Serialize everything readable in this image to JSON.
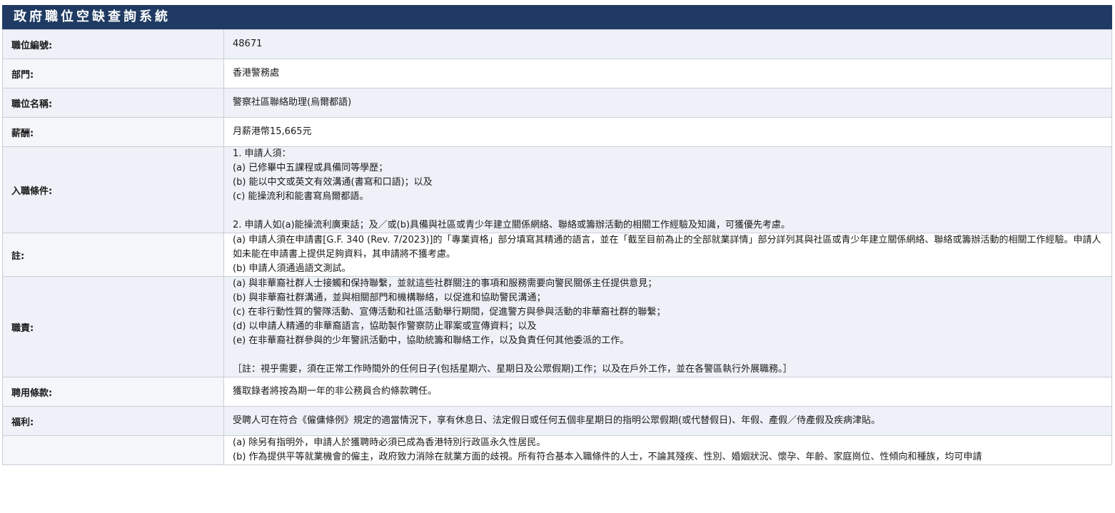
{
  "header": {
    "title": "政府職位空缺查詢系統"
  },
  "rows": [
    {
      "label": "職位編號:",
      "lines": [
        "48671"
      ]
    },
    {
      "label": "部門:",
      "lines": [
        "香港警務處"
      ]
    },
    {
      "label": "職位名稱:",
      "lines": [
        "警察社區聯絡助理(烏爾都語)"
      ]
    },
    {
      "label": "薪酬:",
      "lines": [
        "月薪港幣15,665元"
      ]
    },
    {
      "label": "入職條件:",
      "lines": [
        "1. 申請人須：",
        "(a) 已修畢中五課程或具備同等學歷；",
        "(b) 能以中文或英文有效溝通(書寫和口語)；以及",
        "(c) 能操流利和能書寫烏爾都語。",
        "",
        "2. 申請人如(a)能操流利廣東話；及／或(b)具備與社區或青少年建立關係網絡、聯絡或籌辦活動的相關工作經驗及知識，可獲優先考慮。"
      ]
    },
    {
      "label": "註:",
      "lines": [
        "(a) 申請人須在申請書[G.F. 340 (Rev. 7/2023)]的「專業資格」部分填寫其精通的語言，並在「截至目前為止的全部就業詳情」部分詳列其與社區或青少年建立關係網絡、聯絡或籌辦活動的相關工作經驗。申請人如未能在申請書上提供足夠資料，其申請將不獲考慮。",
        "(b) 申請人須通過語文測試。"
      ]
    },
    {
      "label": "職責:",
      "lines": [
        "(a) 與非華裔社群人士接觸和保持聯繫，並就這些社群關注的事項和服務需要向警民關係主任提供意見；",
        "(b) 與非華裔社群溝通，並與相關部門和機構聯絡，以促進和協助警民溝通；",
        "(c) 在非行動性質的警隊活動、宣傳活動和社區活動舉行期間，促進警方與參與活動的非華裔社群的聯繫；",
        "(d) 以申請人精通的非華裔語言，協助製作警察防止罪案或宣傳資料；以及",
        "(e) 在非華裔社群參與的少年警訊活動中，協助統籌和聯絡工作，以及負責任何其他委派的工作。",
        "",
        "［註：視乎需要，須在正常工作時間外的任何日子(包括星期六、星期日及公眾假期)工作；以及在戶外工作，並在各警區執行外展職務。］"
      ]
    },
    {
      "label": "聘用條款:",
      "lines": [
        "獲取錄者將按為期一年的非公務員合約條款聘任。"
      ]
    },
    {
      "label": "福利:",
      "lines": [
        "受聘人可在符合《僱傭條例》規定的適當情況下，享有休息日、法定假日或任何五個非星期日的指明公眾假期(或代替假日)、年假、產假／侍產假及疾病津貼。"
      ]
    },
    {
      "label": "",
      "lines": [
        "(a) 除另有指明外，申請人於獲聘時必須已成為香港特別行政區永久性居民。",
        "(b) 作為提供平等就業機會的僱主，政府致力消除在就業方面的歧視。所有符合基本入職條件的人士，不論其殘疾、性別、婚姻狀況、懷孕、年齡、家庭崗位、性傾向和種族，均可申請"
      ]
    }
  ]
}
